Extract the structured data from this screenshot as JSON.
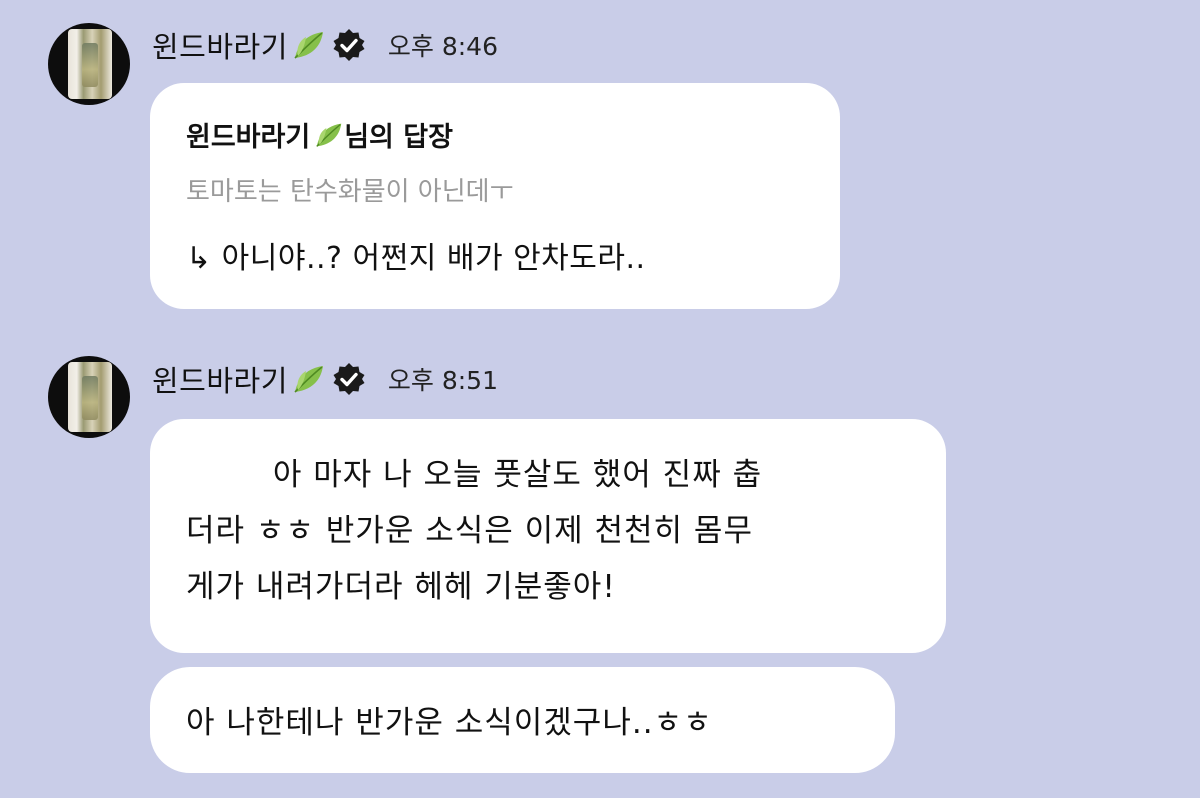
{
  "messages": [
    {
      "sender": "윈드바라기",
      "time": "오후 8:46",
      "reply": {
        "title_name": "윈드바라기",
        "title_suffix": "님의 답장",
        "quote": "토마토는 탄수화물이 아닌데ㅜ",
        "text": "↳ 아니야..? 어쩐지 배가 안차도라.."
      }
    },
    {
      "sender": "윈드바라기",
      "time": "오후 8:51",
      "bubbles": [
        "        아 마자 나 오늘 풋살도 했어 진짜 춥\n더라 ㅎㅎ 반가운 소식은 이제 천천히 몸무\n게가 내려가더라 헤헤 기분좋아!",
        "아 나한테나 반가운 소식이겠구나..ㅎㅎ"
      ]
    }
  ],
  "icons": {
    "leaf": "leaf-emoji-icon",
    "verified": "verified-badge-icon"
  },
  "colors": {
    "background": "#c9cde8",
    "bubble": "#ffffff",
    "quote_text": "#9a9a9a",
    "leaf": "#7bb33a"
  }
}
